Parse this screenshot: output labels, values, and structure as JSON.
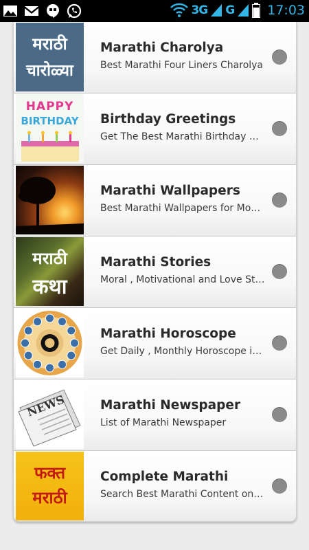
{
  "status_bar": {
    "network_3g": "3G",
    "network_g": "G",
    "time": "17:03",
    "accent_color": "#33b5e5"
  },
  "list": [
    {
      "title": "Marathi Charolya",
      "subtitle": "Best Marathi Four Liners Charolya",
      "thumb_lines": [
        "मराठी",
        "चारोळ्या"
      ],
      "thumb_icon": "marathi-charolya-icon"
    },
    {
      "title": "Birthday Greetings",
      "subtitle": "Get The Best Marathi Birthday Greetings",
      "thumb_lines": [
        "HAPPY",
        "BIRTHDAY"
      ],
      "thumb_icon": "birthday-cake-icon"
    },
    {
      "title": "Marathi Wallpapers",
      "subtitle": "Best Marathi Wallpapers for Mobile",
      "thumb_icon": "sunset-tree-icon"
    },
    {
      "title": "Marathi Stories",
      "subtitle": "Moral , Motivational and Love Stories",
      "thumb_lines": [
        "मराठी",
        "कथा"
      ],
      "thumb_icon": "marathi-katha-icon"
    },
    {
      "title": "Marathi Horoscope",
      "subtitle": "Get Daily , Monthly Horoscope in Marathi",
      "thumb_icon": "zodiac-wheel-icon"
    },
    {
      "title": "Marathi Newspaper",
      "subtitle": "List of Marathi Newspaper",
      "thumb_lines": [
        "NEWS"
      ],
      "thumb_icon": "newspaper-icon"
    },
    {
      "title": "Complete Marathi",
      "subtitle": "Search Best Marathi Content on Web",
      "thumb_lines": [
        "फक्त",
        "मराठी"
      ],
      "thumb_icon": "fakta-marathi-icon"
    }
  ]
}
